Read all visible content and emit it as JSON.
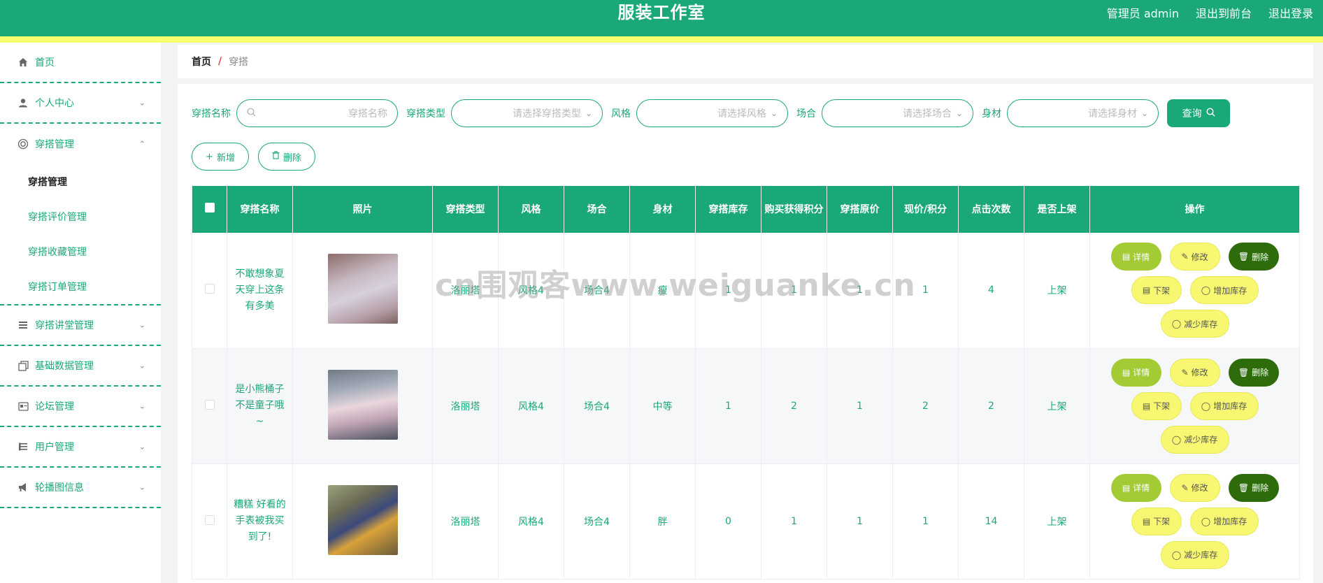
{
  "header": {
    "title": "服装工作室",
    "admin_label": "管理员 admin",
    "back_label": "退出到前台",
    "logout_label": "退出登录"
  },
  "sidebar": {
    "items": [
      {
        "label": "首页",
        "icon": "home-icon"
      },
      {
        "label": "个人中心",
        "icon": "user-icon"
      },
      {
        "label": "穿搭管理",
        "icon": "target-icon"
      },
      {
        "label": "穿搭讲堂管理",
        "icon": "list-icon"
      },
      {
        "label": "基础数据管理",
        "icon": "copy-icon"
      },
      {
        "label": "论坛管理",
        "icon": "card-icon"
      },
      {
        "label": "用户管理",
        "icon": "list-icon"
      },
      {
        "label": "轮播图信息",
        "icon": "bullhorn-icon"
      }
    ],
    "submenu": [
      "穿搭管理",
      "穿搭评价管理",
      "穿搭收藏管理",
      "穿搭订单管理"
    ]
  },
  "breadcrumb": {
    "home": "首页",
    "sep": "/",
    "current": "穿搭"
  },
  "filters": {
    "name_label": "穿搭名称",
    "name_placeholder": "穿搭名称",
    "type_label": "穿搭类型",
    "type_placeholder": "请选择穿搭类型",
    "style_label": "风格",
    "style_placeholder": "请选择风格",
    "occasion_label": "场合",
    "occasion_placeholder": "请选择场合",
    "figure_label": "身材",
    "figure_placeholder": "请选择身材",
    "query_label": "查询"
  },
  "actions": {
    "add_label": "新增",
    "delete_label": "删除"
  },
  "table": {
    "headers": [
      "穿搭名称",
      "照片",
      "穿搭类型",
      "风格",
      "场合",
      "身材",
      "穿搭库存",
      "购买获得积分",
      "穿搭原价",
      "现价/积分",
      "点击次数",
      "是否上架",
      "操作"
    ],
    "rows": [
      {
        "name": "不敢想象夏天穿上这条有多美",
        "type": "洛丽塔",
        "style": "风格4",
        "occasion": "场合4",
        "figure": "瘦",
        "stock": "1",
        "points": "1",
        "orig_price": "1",
        "price": "1",
        "clicks": "4",
        "on_shelf": "上架"
      },
      {
        "name": "是小熊桶子不是童子哦~",
        "type": "洛丽塔",
        "style": "风格4",
        "occasion": "场合4",
        "figure": "中等",
        "stock": "1",
        "points": "2",
        "orig_price": "1",
        "price": "2",
        "clicks": "2",
        "on_shelf": "上架"
      },
      {
        "name": "糟糕 好看的手表被我买到了!",
        "type": "洛丽塔",
        "style": "风格4",
        "occasion": "场合4",
        "figure": "胖",
        "stock": "0",
        "points": "1",
        "orig_price": "1",
        "price": "1",
        "clicks": "14",
        "on_shelf": "上架"
      }
    ],
    "ops": {
      "detail": "详情",
      "edit": "修改",
      "delete": "删除",
      "down": "下架",
      "add_stock": "增加库存",
      "reduce_stock": "减少库存"
    }
  },
  "watermark": "cn围观客www.weiguanke.cn",
  "colors": {
    "primary": "#1aa879",
    "stripe": "#f8ff6e",
    "detail": "#a3cb33",
    "yellow": "#f7f771",
    "delete": "#2d6b0b"
  }
}
